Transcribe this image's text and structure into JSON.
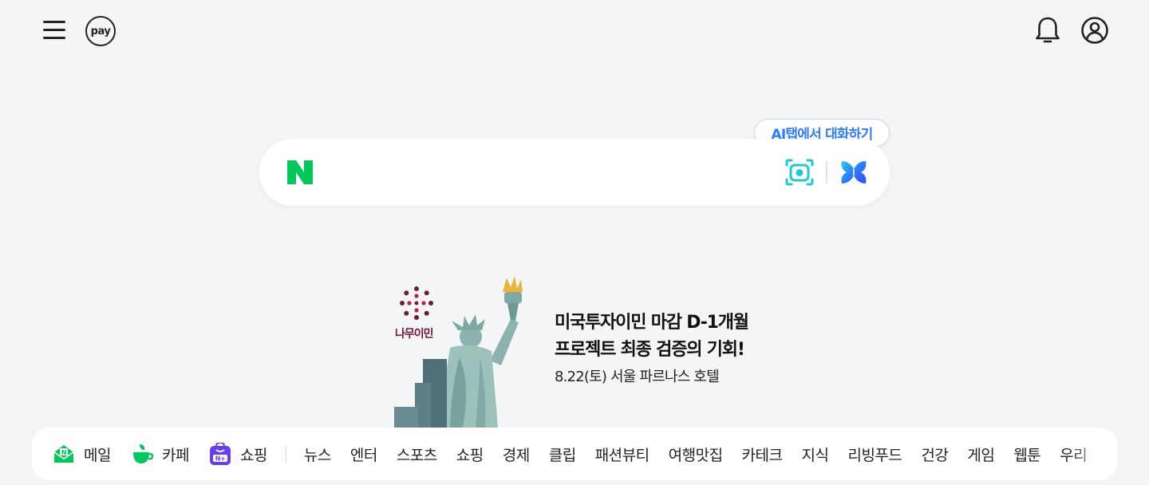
{
  "header": {
    "menu_icon": "hamburger-menu-icon",
    "pay_label": "pay",
    "bell_icon": "bell-icon",
    "account_icon": "account-circle-icon"
  },
  "search": {
    "logo_letter": "N",
    "ai_tooltip": "AI탭에서 대화하기",
    "placeholder": "",
    "lens_icon": "camera-lens-icon",
    "ai_icon": "ai-butterfly-icon"
  },
  "ad": {
    "brand": "나무이민",
    "headline_line1": "미국투자이민 마감 D-1개월",
    "headline_line2": "프로젝트 최종 검증의 기회!",
    "sub": "8.22(토) 서울 파르나스 호텔"
  },
  "nav": {
    "main": [
      {
        "label": "메일",
        "icon": "mail-icon"
      },
      {
        "label": "카페",
        "icon": "cafe-cup-icon"
      },
      {
        "label": "쇼핑",
        "icon": "shopping-bag-icon"
      }
    ],
    "categories": [
      "뉴스",
      "엔터",
      "스포츠",
      "쇼핑",
      "경제",
      "클립",
      "패션뷰티",
      "여행맛집",
      "카테크",
      "지식",
      "리빙푸드",
      "건강",
      "게임",
      "웹툰",
      "우리"
    ]
  },
  "colors": {
    "background": "#f3f5f7",
    "naver_green": "#03c75a",
    "ai_blue": "#2f7cf6",
    "lens_teal": "#1fc8d4"
  }
}
